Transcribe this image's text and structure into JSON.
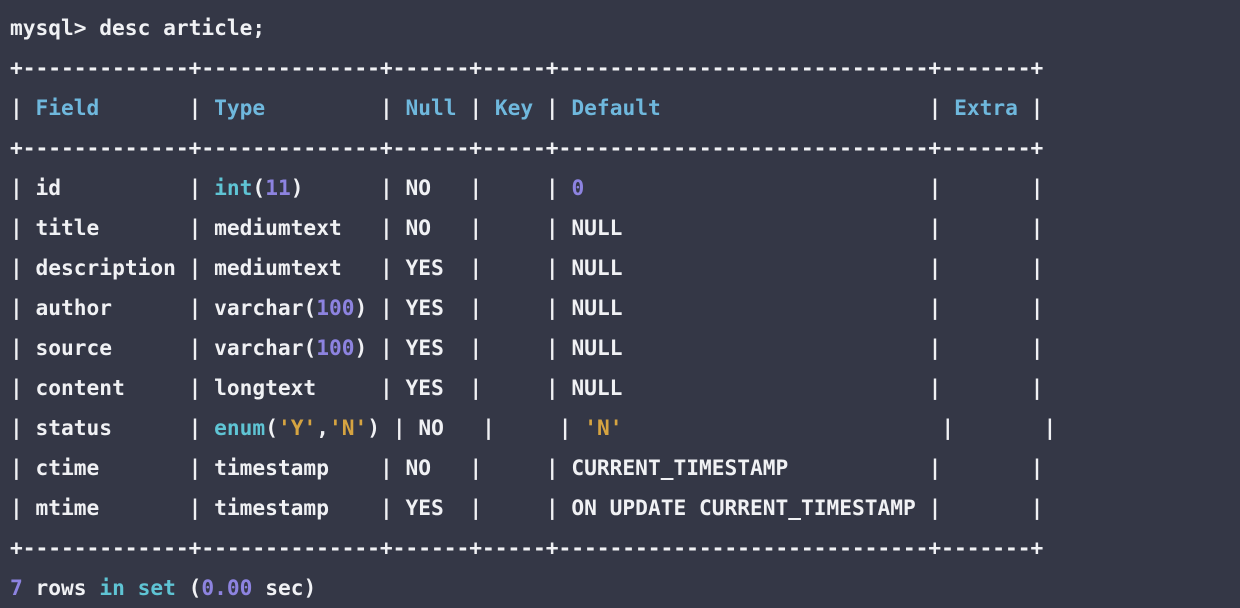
{
  "terminal": {
    "background_color": "#343746",
    "foreground_color": "#f0f1f4",
    "palette": {
      "white": "#f0f1f4",
      "cyan": "#5fc4d4",
      "header_blue": "#6fb8dd",
      "purple": "#8d83e0",
      "gold": "#d6a441"
    },
    "prompt": {
      "prefix": "mysql> ",
      "command": "desc article;"
    },
    "separator_line": "+-------------+--------------+------+-----+-----------------------------+-------+",
    "table": {
      "columns": [
        {
          "label": "Field",
          "width": 11
        },
        {
          "label": "Type",
          "width": 12
        },
        {
          "label": "Null",
          "width": 4
        },
        {
          "label": "Key",
          "width": 3
        },
        {
          "label": "Default",
          "width": 27
        },
        {
          "label": "Extra",
          "width": 5
        }
      ],
      "rows": [
        {
          "field": "id",
          "type_tokens": [
            {
              "text": "int",
              "color": "cyan"
            },
            {
              "text": "(",
              "color": "white"
            },
            {
              "text": "11",
              "color": "purple"
            },
            {
              "text": ")",
              "color": "white"
            }
          ],
          "type_plain": "int(11)",
          "null": "NO",
          "key": "",
          "default_tokens": [
            {
              "text": "0",
              "color": "purple"
            }
          ],
          "default_plain": "0",
          "extra": ""
        },
        {
          "field": "title",
          "type_tokens": [
            {
              "text": "mediumtext",
              "color": "white"
            }
          ],
          "type_plain": "mediumtext",
          "null": "NO",
          "key": "",
          "default_tokens": [
            {
              "text": "NULL",
              "color": "white"
            }
          ],
          "default_plain": "NULL",
          "extra": ""
        },
        {
          "field": "description",
          "type_tokens": [
            {
              "text": "mediumtext",
              "color": "white"
            }
          ],
          "type_plain": "mediumtext",
          "null": "YES",
          "key": "",
          "default_tokens": [
            {
              "text": "NULL",
              "color": "white"
            }
          ],
          "default_plain": "NULL",
          "extra": ""
        },
        {
          "field": "author",
          "type_tokens": [
            {
              "text": "varchar",
              "color": "white"
            },
            {
              "text": "(",
              "color": "white"
            },
            {
              "text": "100",
              "color": "purple"
            },
            {
              "text": ")",
              "color": "white"
            }
          ],
          "type_plain": "varchar(100)",
          "null": "YES",
          "key": "",
          "default_tokens": [
            {
              "text": "NULL",
              "color": "white"
            }
          ],
          "default_plain": "NULL",
          "extra": ""
        },
        {
          "field": "source",
          "type_tokens": [
            {
              "text": "varchar",
              "color": "white"
            },
            {
              "text": "(",
              "color": "white"
            },
            {
              "text": "100",
              "color": "purple"
            },
            {
              "text": ")",
              "color": "white"
            }
          ],
          "type_plain": "varchar(100)",
          "null": "YES",
          "key": "",
          "default_tokens": [
            {
              "text": "NULL",
              "color": "white"
            }
          ],
          "default_plain": "NULL",
          "extra": ""
        },
        {
          "field": "content",
          "type_tokens": [
            {
              "text": "longtext",
              "color": "white"
            }
          ],
          "type_plain": "longtext",
          "null": "YES",
          "key": "",
          "default_tokens": [
            {
              "text": "NULL",
              "color": "white"
            }
          ],
          "default_plain": "NULL",
          "extra": ""
        },
        {
          "field": "status",
          "type_tokens": [
            {
              "text": "enum",
              "color": "cyan"
            },
            {
              "text": "(",
              "color": "white"
            },
            {
              "text": "'Y'",
              "color": "gold"
            },
            {
              "text": ",",
              "color": "white"
            },
            {
              "text": "'N'",
              "color": "gold"
            },
            {
              "text": ")",
              "color": "white"
            }
          ],
          "type_plain": "enum('Y','N')",
          "null": "NO",
          "key": "",
          "default_tokens": [
            {
              "text": "'N'",
              "color": "gold"
            }
          ],
          "default_plain": "'N'",
          "extra": ""
        },
        {
          "field": "ctime",
          "type_tokens": [
            {
              "text": "timestamp",
              "color": "white"
            }
          ],
          "type_plain": "timestamp",
          "null": "NO",
          "key": "",
          "default_tokens": [
            {
              "text": "CURRENT_TIMESTAMP",
              "color": "white"
            }
          ],
          "default_plain": "CURRENT_TIMESTAMP",
          "extra": ""
        },
        {
          "field": "mtime",
          "type_tokens": [
            {
              "text": "timestamp",
              "color": "white"
            }
          ],
          "type_plain": "timestamp",
          "null": "YES",
          "key": "",
          "default_tokens": [
            {
              "text": "ON UPDATE CURRENT_TIMESTAMP",
              "color": "white"
            }
          ],
          "default_plain": "ON UPDATE CURRENT_TIMESTAMP",
          "extra": ""
        }
      ]
    },
    "status_line": {
      "count": "7",
      "rows_word": "rows",
      "in_set": "in set",
      "open_paren": "(",
      "elapsed": "0.00",
      "sec_word": "sec",
      "close_paren": ")"
    }
  }
}
